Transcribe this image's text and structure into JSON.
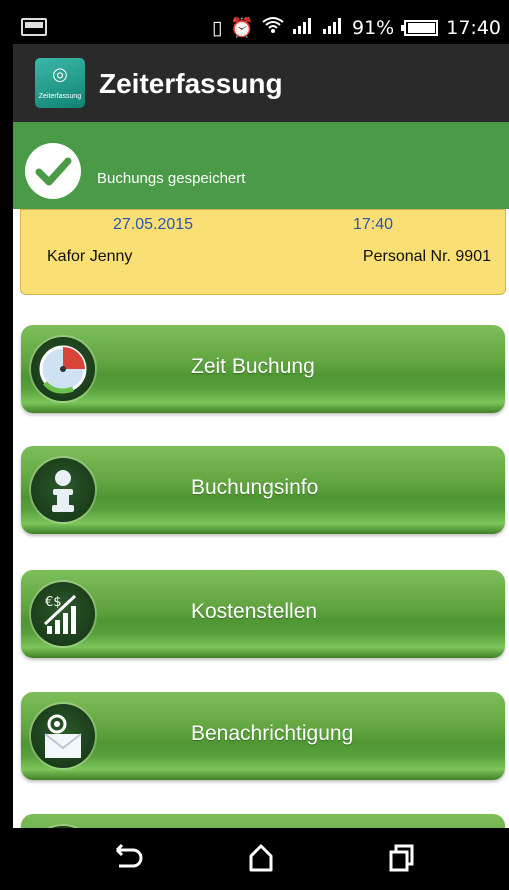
{
  "status_bar": {
    "battery_percent": "91%",
    "battery_level": 0.91,
    "time": "17:40",
    "icons": [
      "image-icon",
      "vibrate-icon",
      "alarm-icon",
      "wifi-icon",
      "signal-1-icon",
      "signal-2-icon",
      "battery-icon"
    ]
  },
  "app_bar": {
    "logo_text": "Zeiterfassung",
    "title": "Zeiterfassung"
  },
  "toast": {
    "message": "Buchungs gespeichert"
  },
  "info": {
    "date": "27.05.2015",
    "time": "17:40",
    "name": "Kafor Jenny",
    "personnel": "Personal Nr. 9901"
  },
  "menu": [
    {
      "label": "Zeit Buchung",
      "icon": "stopwatch-icon"
    },
    {
      "label": "Buchungsinfo",
      "icon": "info-icon"
    },
    {
      "label": "Kostenstellen",
      "icon": "cost-chart-icon"
    },
    {
      "label": "Benachrichtigung",
      "icon": "mail-icon"
    },
    {
      "label": "",
      "icon": "partial-icon"
    }
  ],
  "nav_bar": {
    "back": "back-icon",
    "home": "home-icon",
    "recents": "recents-icon"
  },
  "colors": {
    "toast_green": "#4a9a48",
    "button_green": "#61a540",
    "info_yellow": "#f9df74",
    "info_blue": "#2d55b0",
    "app_bar": "#2a2a2a"
  }
}
